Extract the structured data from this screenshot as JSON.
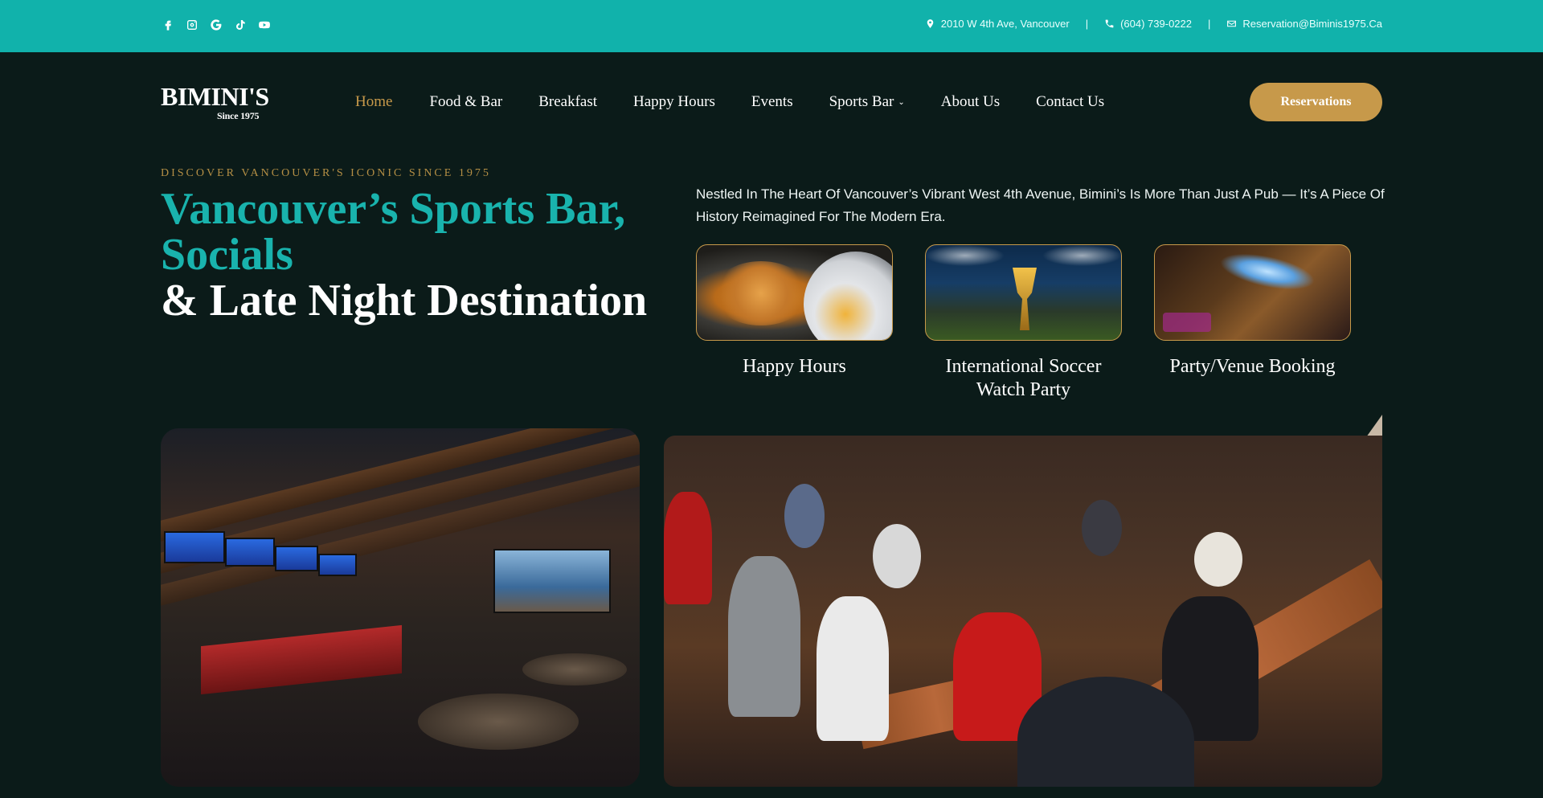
{
  "topbar": {
    "social_icons": [
      "facebook-icon",
      "instagram-icon",
      "google-icon",
      "tiktok-icon",
      "youtube-icon"
    ],
    "address": "2010 W 4th Ave, Vancouver",
    "phone": "(604) 739-0222",
    "email": "Reservation@Biminis1975.Ca",
    "separator": "|"
  },
  "brand": {
    "name": "BIMINI'S",
    "since": "Since 1975"
  },
  "nav": {
    "items": [
      {
        "label": "Home",
        "active": true
      },
      {
        "label": "Food & Bar"
      },
      {
        "label": "Breakfast"
      },
      {
        "label": "Happy Hours"
      },
      {
        "label": "Events"
      },
      {
        "label": "Sports Bar",
        "has_dropdown": true
      },
      {
        "label": "About Us"
      },
      {
        "label": "Contact Us"
      }
    ],
    "dropdown_glyph": "⌄",
    "cta": "Reservations"
  },
  "hero": {
    "eyebrow": "DISCOVER VANCOUVER'S ICONIC SINCE 1975",
    "headline_teal": "Vancouver’s Sports Bar, Socials",
    "headline_white": "& Late Night Destination",
    "intro": "Nestled In The Heart Of Vancouver’s Vibrant West 4th Avenue, Bimini’s Is More Than Just A Pub — It’s A Piece Of History Reimagined For The Modern Era."
  },
  "cards": [
    {
      "caption": "Happy Hours"
    },
    {
      "caption": "International Soccer Watch Party"
    },
    {
      "caption": "Party/Venue Booking"
    }
  ],
  "colors": {
    "teal": "#11b2ab",
    "dark_bg": "#0b1b19",
    "gold": "#c7994a"
  }
}
